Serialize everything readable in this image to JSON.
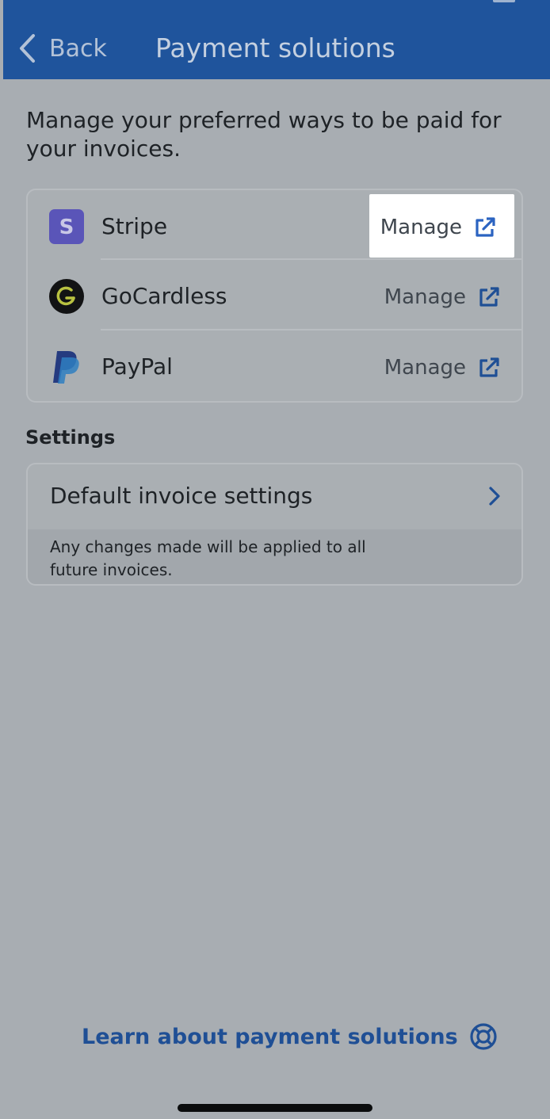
{
  "header": {
    "back_label": "Back",
    "title": "Payment solutions"
  },
  "intro_text": "Manage your preferred ways to be paid for your invoices.",
  "providers": [
    {
      "name": "Stripe",
      "manage_label": "Manage",
      "icon": "stripe-logo"
    },
    {
      "name": "GoCardless",
      "manage_label": "Manage",
      "icon": "gocardless-logo"
    },
    {
      "name": "PayPal",
      "manage_label": "Manage",
      "icon": "paypal-logo"
    }
  ],
  "settings": {
    "heading": "Settings",
    "default_invoice_label": "Default invoice settings",
    "note": "Any changes made will be applied to all future invoices."
  },
  "footer": {
    "learn_link": "Learn about payment solutions",
    "learn_icon": "lifebuoy-icon"
  },
  "colors": {
    "header": "#1f549c",
    "backdrop": "#a8adb2",
    "link": "#1f4f95",
    "stripe": "#5a55b8"
  }
}
